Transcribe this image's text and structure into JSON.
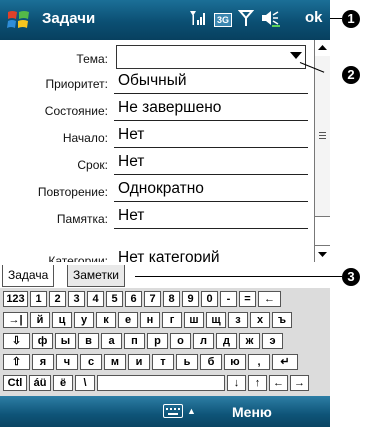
{
  "title_bar": {
    "app_title": "Задачи",
    "ok_label": "ok",
    "tray": {
      "network_icon": "3G"
    }
  },
  "form": {
    "fields": [
      {
        "label": "Тема:",
        "value": ""
      },
      {
        "label": "Приоритет:",
        "value": "Обычный"
      },
      {
        "label": "Состояние:",
        "value": "Не завершено"
      },
      {
        "label": "Начало:",
        "value": "Нет"
      },
      {
        "label": "Срок:",
        "value": "Нет"
      },
      {
        "label": "Повторение:",
        "value": "Однократно"
      },
      {
        "label": "Памятка:",
        "value": "Нет"
      },
      {
        "label": "Категории:",
        "value": "Нет категорий"
      }
    ]
  },
  "tabs": [
    {
      "label": "Задача"
    },
    {
      "label": "Заметки"
    }
  ],
  "keyboard": {
    "rows": [
      [
        "123",
        "1",
        "2",
        "3",
        "4",
        "5",
        "6",
        "7",
        "8",
        "9",
        "0",
        "-",
        "=",
        "←"
      ],
      [
        "→|",
        "й",
        "ц",
        "у",
        "к",
        "е",
        "н",
        "г",
        "ш",
        "щ",
        "з",
        "х",
        "ъ"
      ],
      [
        "⇩",
        "ф",
        "ы",
        "в",
        "а",
        "п",
        "р",
        "о",
        "л",
        "д",
        "ж",
        "э"
      ],
      [
        "⇧",
        "я",
        "ч",
        "с",
        "м",
        "и",
        "т",
        "ь",
        "б",
        "ю",
        ",",
        "↵"
      ],
      [
        "Ctl",
        "áü",
        "ё",
        "\\",
        "",
        "↓",
        "↑",
        "←",
        "→"
      ]
    ]
  },
  "bottom_bar": {
    "menu_label": "Меню"
  },
  "callouts": [
    "1",
    "2",
    "3"
  ]
}
